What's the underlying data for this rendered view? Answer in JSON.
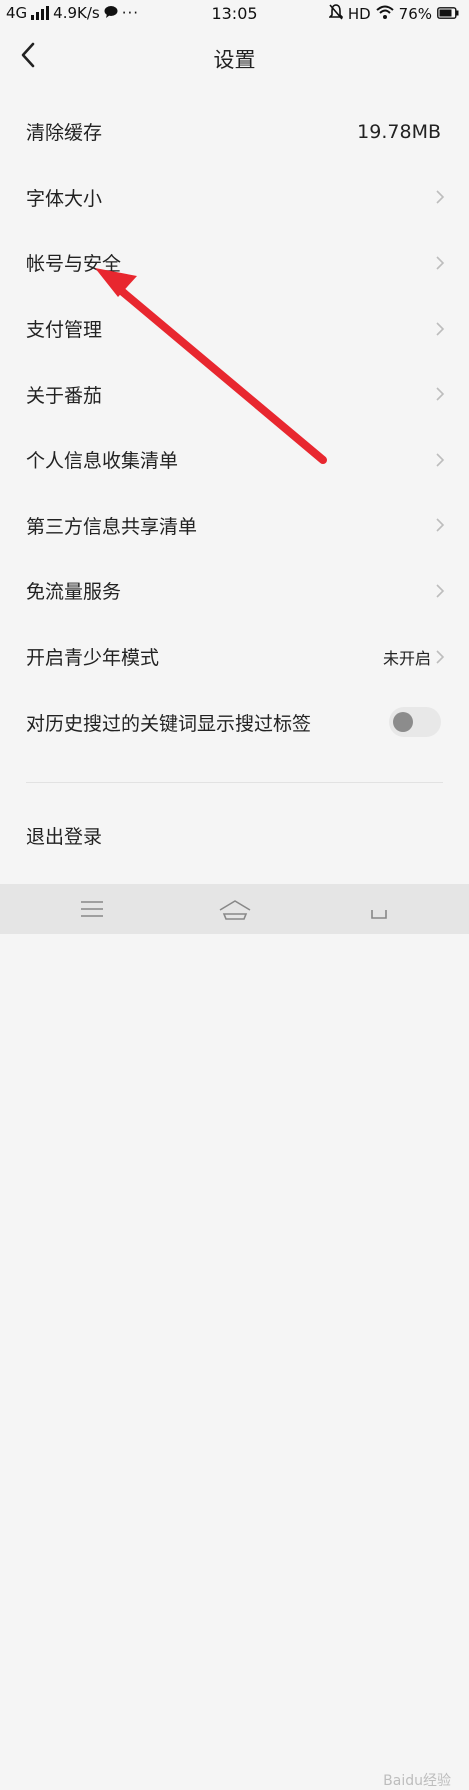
{
  "status_bar": {
    "network": "4G",
    "speed": "4.9K/s",
    "time": "13:05",
    "hd": "HD",
    "battery": "76%"
  },
  "header": {
    "title": "设置"
  },
  "settings": [
    {
      "label": "清除缓存",
      "value": "19.78MB"
    },
    {
      "label": "字体大小"
    },
    {
      "label": "帐号与安全"
    },
    {
      "label": "支付管理"
    },
    {
      "label": "关于番茄"
    },
    {
      "label": "个人信息收集清单"
    },
    {
      "label": "第三方信息共享清单"
    },
    {
      "label": "免流量服务"
    },
    {
      "label": "开启青少年模式",
      "value": "未开启"
    },
    {
      "label": "对历史搜过的关键词显示搜过标签",
      "toggle": false
    }
  ],
  "logout_label": "退出登录",
  "watermark": "Baidu经验",
  "colors": {
    "annotation_arrow": "#e8272f",
    "toggle_off": "#8c8c8c"
  }
}
